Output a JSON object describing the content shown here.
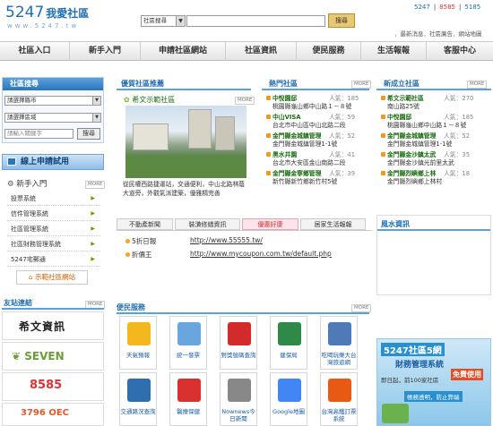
{
  "header": {
    "logo_number": "5247",
    "logo_text": "我愛社區",
    "logo_url": "www.5247.tw",
    "search_select": "社區搜尋",
    "search_button": "搜尋",
    "stats": [
      "5247",
      "8585",
      "5185"
    ],
    "top_links": "．最新消息．社區廣告．網站地圖"
  },
  "nav": [
    "社區入口",
    "新手入門",
    "申請社區網站",
    "社區資訊",
    "便民服務",
    "生活報報",
    "客服中心"
  ],
  "left": {
    "search_title": "社區搜尋",
    "select_city": "請選擇縣市",
    "select_area": "請選擇區域",
    "keyword_placeholder": "請輸入關鍵字",
    "search_button": "搜尋",
    "apply_title": "線上申請試用",
    "newbie_title": "新手入門",
    "more": "MORE",
    "menu": [
      "投票系統",
      "信件管理系統",
      "社區管理系統",
      "社區財務管理系統",
      "5247宅郵通"
    ],
    "demo_button": "示範社區網站"
  },
  "featured": {
    "title": "優質社區推薦",
    "name": "希文示範社區",
    "more": "MORE",
    "desc": "從民權西路捷運站，交通便利，中山北路林蔭大道旁，外觀氣派建築，優雅精完善"
  },
  "hot": {
    "title": "熱門社區",
    "more": "MORE",
    "items": [
      {
        "name": "中悅園邸",
        "count": "人氣：185",
        "addr": "桃園縣龜山鄉中山路１－８號"
      },
      {
        "name": "中山VISA",
        "count": "人氣：59",
        "addr": "台北市中山區中山北路二段"
      },
      {
        "name": "金門縣金城鎮管理",
        "count": "人氣：52",
        "addr": "金門縣金城鎮管理1-1號"
      },
      {
        "name": "黑水井園",
        "count": "人氣：41",
        "addr": "台北市大安區金山南路二段"
      },
      {
        "name": "金門縣金寧鄉管理",
        "count": "人氣：39",
        "addr": "新竹縣新竹鄉新竹村5號"
      }
    ]
  },
  "newest": {
    "title": "新成立社區",
    "more": "MORE",
    "items": [
      {
        "name": "希文示範社區",
        "count": "人氣：270",
        "addr": "南山路25號"
      },
      {
        "name": "中悅園邸",
        "count": "人氣：185",
        "addr": "桃園縣龜山鄉中山路１－８號"
      },
      {
        "name": "金門縣金城鎮管理",
        "count": "人氣：52",
        "addr": "金門縣金城鎮管理1-1號"
      },
      {
        "name": "金門縣金沙鎮太武",
        "count": "人氣：35",
        "addr": "金門縣金沙鎮光前里太武"
      },
      {
        "name": "金門縣烈嶼鄉上林",
        "count": "人氣：18",
        "addr": "金門縣烈嶼鄉上林村"
      }
    ]
  },
  "tabs": [
    "不動產新聞",
    "裝潢修繕資訊",
    "優惠好康",
    "居家生活報報"
  ],
  "deals": [
    {
      "name": "5折日報",
      "url": "http://www.55555.tw/"
    },
    {
      "name": "折價王",
      "url": "http://www.mycoupon.com.tw/default.php"
    }
  ],
  "weather": {
    "title": "風水資訊"
  },
  "friends": {
    "title": "友站連結",
    "more": "MORE",
    "items": [
      "希文資訊",
      "SEVEN",
      "8585",
      "3796 OEC"
    ]
  },
  "services": {
    "title": "便民服務",
    "more": "MORE",
    "items": [
      {
        "label": "天氣預報",
        "color": "#f4b81e"
      },
      {
        "label": "統一發票",
        "color": "#6aa6de"
      },
      {
        "label": "對獎號碼查詢",
        "color": "#d32b2b"
      },
      {
        "label": "健保局",
        "color": "#2f8a4a"
      },
      {
        "label": "吃喝玩樂大台灣旅遊網",
        "color": "#4e7ab8"
      },
      {
        "label": "交通路況查詢",
        "color": "#2f6fb0"
      },
      {
        "label": "醫療保健",
        "color": "#d93030"
      },
      {
        "label": "Nownews今日新聞",
        "color": "#888888"
      },
      {
        "label": "Google地圖",
        "color": "#4285f4"
      },
      {
        "label": "台灣高鐵訂票系統",
        "color": "#e85a14"
      }
    ]
  },
  "ad": {
    "title": "5247社區5網",
    "subtitle": "財務管理系統",
    "badge": "免費使用",
    "line1": "即日起，前100家社區",
    "line2": "帳務透明，防止弊端"
  }
}
